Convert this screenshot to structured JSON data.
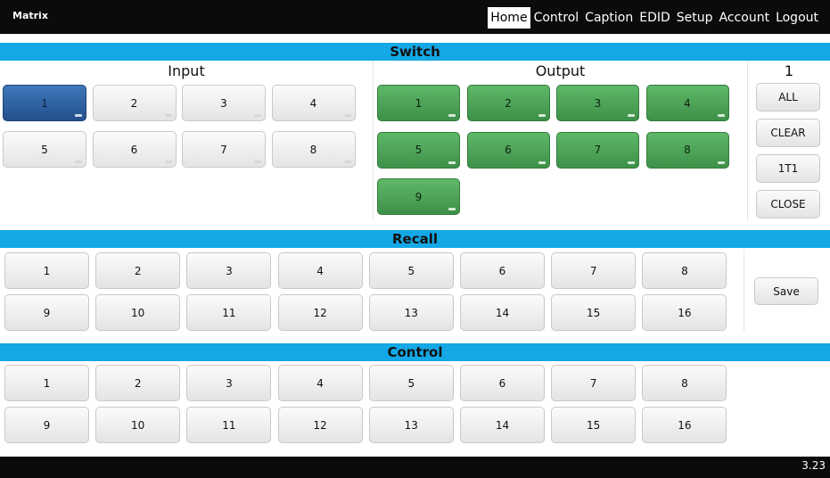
{
  "header": {
    "brand": "Matrix",
    "nav": [
      "Home",
      "Control",
      "Caption",
      "EDID",
      "Setup",
      "Account",
      "Logout"
    ],
    "active_nav": "Home"
  },
  "switch": {
    "title": "Switch",
    "input_title": "Input",
    "output_title": "Output",
    "inputs": [
      "1",
      "2",
      "3",
      "4",
      "5",
      "6",
      "7",
      "8"
    ],
    "selected_input": "1",
    "outputs": [
      "1",
      "2",
      "3",
      "4",
      "5",
      "6",
      "7",
      "8",
      "9"
    ],
    "current_input_display": "1",
    "side_buttons": [
      "ALL",
      "CLEAR",
      "1T1",
      "CLOSE"
    ]
  },
  "recall": {
    "title": "Recall",
    "presets": [
      "1",
      "2",
      "3",
      "4",
      "5",
      "6",
      "7",
      "8",
      "9",
      "10",
      "11",
      "12",
      "13",
      "14",
      "15",
      "16"
    ],
    "save_label": "Save"
  },
  "control": {
    "title": "Control",
    "items": [
      "1",
      "2",
      "3",
      "4",
      "5",
      "6",
      "7",
      "8",
      "9",
      "10",
      "11",
      "12",
      "13",
      "14",
      "15",
      "16"
    ]
  },
  "footer": {
    "version": "3.23"
  },
  "colors": {
    "accent": "#14a8e6",
    "selected": "#2e62a3",
    "active_output": "#4ea85a",
    "bar": "#0b0b0b"
  }
}
